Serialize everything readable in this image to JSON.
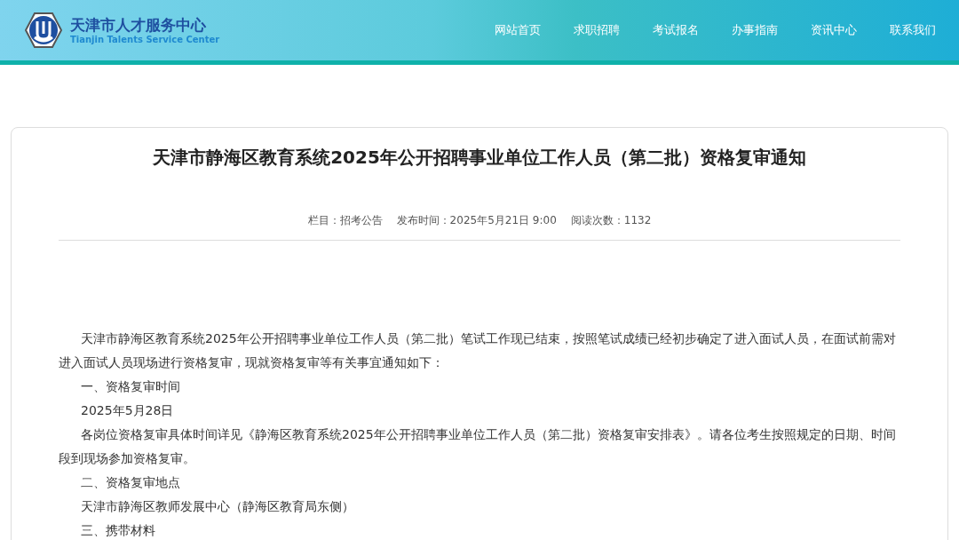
{
  "header": {
    "logo_title": "天津市人才服务中心",
    "logo_subtitle": "Tianjin Talents Service Center"
  },
  "nav": [
    {
      "label": "网站首页"
    },
    {
      "label": "求职招聘"
    },
    {
      "label": "考试报名"
    },
    {
      "label": "办事指南"
    },
    {
      "label": "资讯中心"
    },
    {
      "label": "联系我们"
    }
  ],
  "article": {
    "title": "天津市静海区教育系统2025年公开招聘事业单位工作人员（第二批）资格复审通知",
    "meta": [
      "栏目：招考公告",
      "发布时间：2025年5月21日 9:00",
      "阅读次数：1132"
    ],
    "paragraphs": [
      "天津市静海区教育系统2025年公开招聘事业单位工作人员（第二批）笔试工作现已结束，按照笔试成绩已经初步确定了进入面试人员，在面试前需对进入面试人员现场进行资格复审，现就资格复审等有关事宜通知如下：",
      "一、资格复审时间",
      "2025年5月28日",
      "各岗位资格复审具体时间详见《静海区教育系统2025年公开招聘事业单位工作人员（第二批）资格复审安排表》。请各位考生按照规定的日期、时间段到现场参加资格复审。",
      "二、资格复审地点",
      "天津市静海区教师发展中心（静海区教育局东侧）",
      "三、携带材料"
    ]
  }
}
